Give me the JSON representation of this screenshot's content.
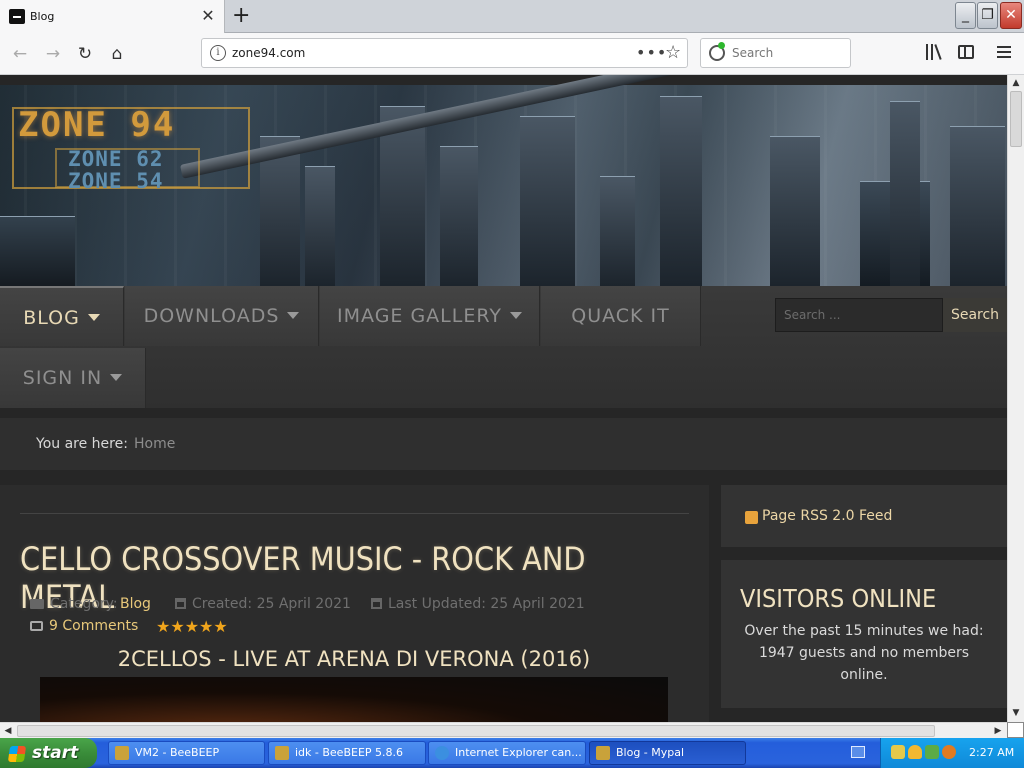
{
  "browser": {
    "tab_title": "Blog",
    "tab_close": "✕",
    "new_tab": "+",
    "url": "zone94.com",
    "url_actions": "•••",
    "search_placeholder": "Search",
    "window": {
      "minimize": "_",
      "maximize": "❐",
      "close": "✕"
    }
  },
  "site": {
    "logo": {
      "main": "ZONE 94",
      "sub1": "ZONE 62",
      "sub2": "ZONE 54"
    },
    "menu": [
      {
        "label": "BLOG",
        "has_dropdown": true,
        "active": true
      },
      {
        "label": "DOWNLOADS",
        "has_dropdown": true
      },
      {
        "label": "IMAGE GALLERY",
        "has_dropdown": true
      },
      {
        "label": "QUACK IT",
        "has_dropdown": false
      },
      {
        "label": "SIGN IN",
        "has_dropdown": true
      }
    ],
    "search": {
      "placeholder": "Search ...",
      "button": "Search"
    },
    "breadcrumb": {
      "label": "You are here:",
      "home": "Home"
    },
    "article": {
      "title": "CELLO CROSSOVER MUSIC - ROCK AND METAL",
      "category_label": "Category:",
      "category": "Blog",
      "created": "Created: 25 April 2021",
      "updated": "Last Updated: 25 April 2021",
      "comments": "9 Comments",
      "rating_stars": 5,
      "stars": "★★★★★",
      "video_title": "2CELLOS - LIVE AT ARENA DI VERONA (2016)"
    },
    "sidebar": {
      "rss": "Page RSS 2.0 Feed",
      "visitors_title": "VISITORS ONLINE",
      "visitors_text": "Over the past 15 minutes we had: 1947 guests and no members online."
    }
  },
  "colors": {
    "accent": "#e8c87a",
    "heading": "#f0e2c0",
    "star": "#f0a51c",
    "page_bg": "#262626"
  },
  "taskbar": {
    "start": "start",
    "tasks": [
      "VM2 - BeeBEEP",
      "idk - BeeBEEP 5.8.6",
      "Internet Explorer can...",
      "Blog - Mypal"
    ],
    "clock": "2:27 AM"
  }
}
